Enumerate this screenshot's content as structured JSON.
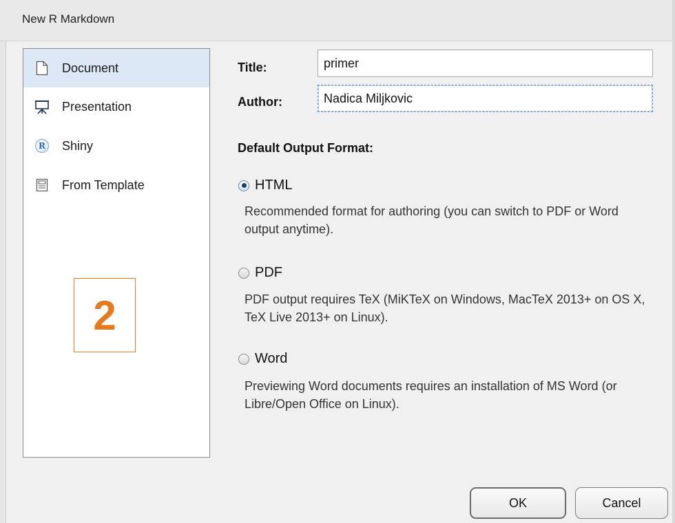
{
  "window": {
    "title": "New R Markdown"
  },
  "sidebar": {
    "items": [
      {
        "label": "Document",
        "icon": "document-icon",
        "selected": true
      },
      {
        "label": "Presentation",
        "icon": "presentation-icon",
        "selected": false
      },
      {
        "label": "Shiny",
        "icon": "shiny-r-icon",
        "selected": false
      },
      {
        "label": "From Template",
        "icon": "template-icon",
        "selected": false
      }
    ],
    "badge": "2",
    "badge_color": "#e87a1e",
    "selected_bg": "#dce8f5"
  },
  "form": {
    "title_label": "Title:",
    "title_value": "primer",
    "author_label": "Author:",
    "author_value": "Nadica Miljkovic"
  },
  "output_format": {
    "label": "Default Output Format:",
    "options": [
      {
        "label": "HTML",
        "checked": true,
        "description": "Recommended format for authoring (you can switch to PDF or Word output anytime)."
      },
      {
        "label": "PDF",
        "checked": false,
        "description": "PDF output requires TeX (MiKTeX on Windows, MacTeX 2013+ on OS X, TeX Live 2013+ on Linux)."
      },
      {
        "label": "Word",
        "checked": false,
        "description": "Previewing Word documents requires an installation of MS Word (or Libre/Open Office on Linux)."
      }
    ]
  },
  "buttons": {
    "ok": "OK",
    "cancel": "Cancel"
  }
}
